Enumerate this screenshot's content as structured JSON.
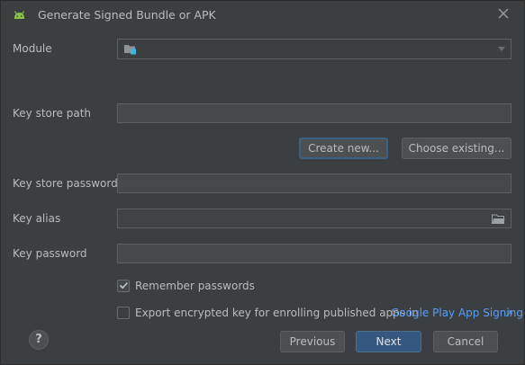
{
  "window": {
    "title": "Generate Signed Bundle or APK"
  },
  "icons": {
    "app": "android-icon",
    "close": "close-icon",
    "module": "module-folder-icon",
    "browse": "folder-icon",
    "help": "help-icon"
  },
  "form": {
    "module_label": "Module",
    "module_value": "",
    "key_store_path_label": "Key store path",
    "key_store_path_value": "",
    "create_new_label": "Create new...",
    "choose_existing_label": "Choose existing...",
    "key_store_password_label": "Key store password",
    "key_store_password_value": "",
    "key_alias_label": "Key alias",
    "key_alias_value": "",
    "key_password_label": "Key password",
    "key_password_value": "",
    "remember_passwords_label": "Remember passwords",
    "remember_passwords_checked": true,
    "export_key_label": "Export encrypted key for enrolling published apps in",
    "export_key_checked": false,
    "play_signing_link": "Google Play App Signing"
  },
  "footer": {
    "help_label": "?",
    "previous_label": "Previous",
    "next_label": "Next",
    "cancel_label": "Cancel"
  },
  "colors": {
    "accent": "#365880",
    "link": "#589df6",
    "focus_border": "#3d6185",
    "background": "#3c3f41"
  }
}
